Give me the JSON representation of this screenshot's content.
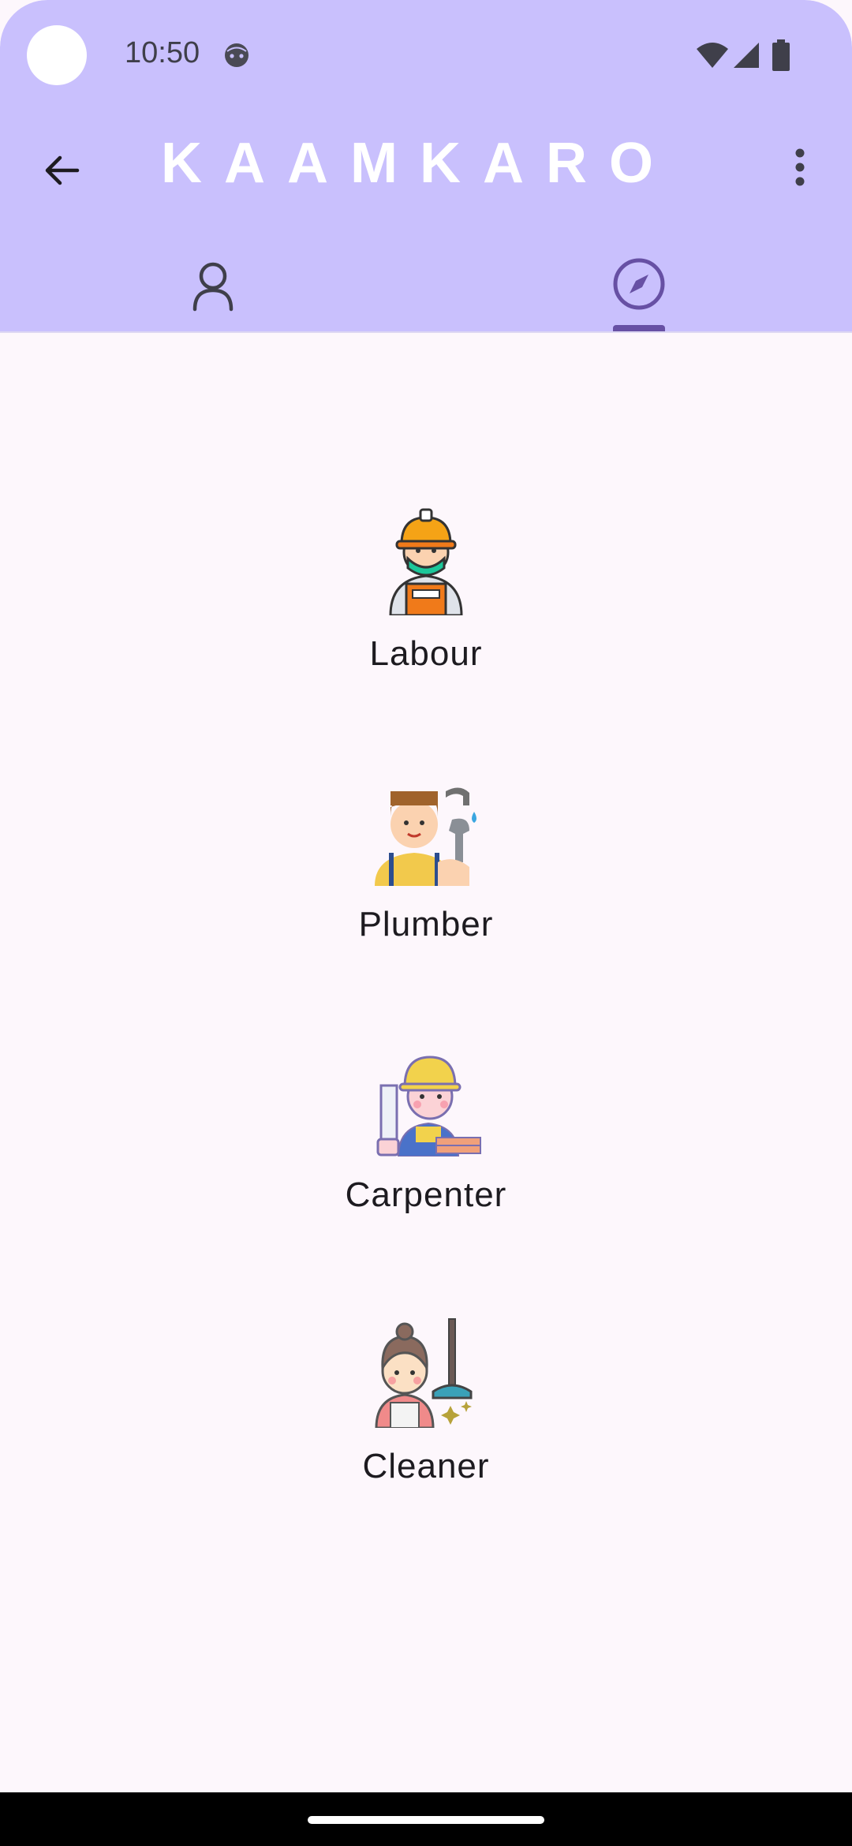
{
  "status_bar": {
    "time": "10:50"
  },
  "app_bar": {
    "title": "KAAMKARO"
  },
  "tabs": [
    {
      "name": "profile",
      "selected": false
    },
    {
      "name": "explore",
      "selected": true
    }
  ],
  "services": [
    {
      "label": "Labour"
    },
    {
      "label": "Plumber"
    },
    {
      "label": "Carpenter"
    },
    {
      "label": "Cleaner"
    }
  ],
  "colors": {
    "header": "#c9c0fd",
    "accent": "#6750a4",
    "background": "#fdf7fc"
  }
}
